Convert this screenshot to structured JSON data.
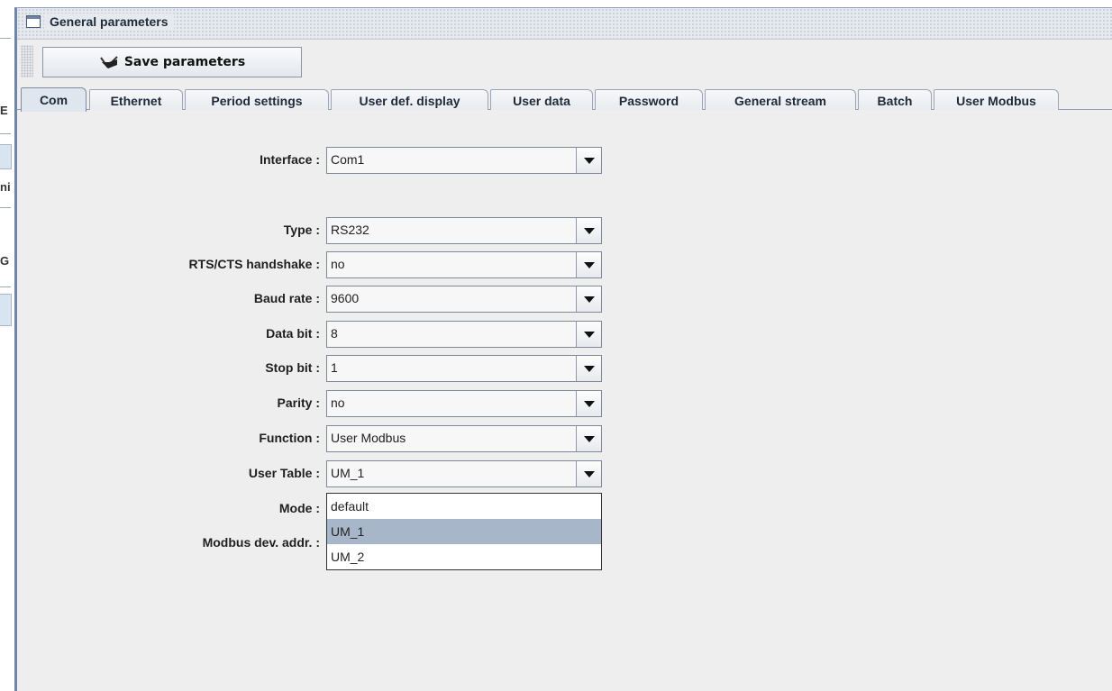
{
  "window": {
    "title": "General parameters"
  },
  "toolbar": {
    "save_label": "Save parameters"
  },
  "tabs": [
    {
      "label": "Com",
      "active": true
    },
    {
      "label": "Ethernet"
    },
    {
      "label": "Period settings"
    },
    {
      "label": "User def. display"
    },
    {
      "label": "User data"
    },
    {
      "label": "Password"
    },
    {
      "label": "General stream"
    },
    {
      "label": "Batch"
    },
    {
      "label": "User Modbus"
    }
  ],
  "form": {
    "interface": {
      "label": "Interface :",
      "value": "Com1"
    },
    "type": {
      "label": "Type :",
      "value": "RS232"
    },
    "rts_cts": {
      "label": "RTS/CTS handshake :",
      "value": "no"
    },
    "baud_rate": {
      "label": "Baud rate :",
      "value": "9600"
    },
    "data_bit": {
      "label": "Data bit :",
      "value": "8"
    },
    "stop_bit": {
      "label": "Stop bit :",
      "value": "1"
    },
    "parity": {
      "label": "Parity :",
      "value": "no"
    },
    "function": {
      "label": "Function :",
      "value": "User Modbus"
    },
    "user_table": {
      "label": "User Table :",
      "value": "UM_1"
    },
    "mode": {
      "label": "Mode :"
    },
    "modbus_addr": {
      "label": "Modbus dev. addr. :"
    }
  },
  "user_table_dropdown": {
    "options": [
      "default",
      "UM_1",
      "UM_2"
    ],
    "selected": "UM_1"
  },
  "colors": {
    "frame_border": "#6f86a6",
    "selected_option": "#a8b6c9",
    "panel_bg": "#eeeeee"
  }
}
